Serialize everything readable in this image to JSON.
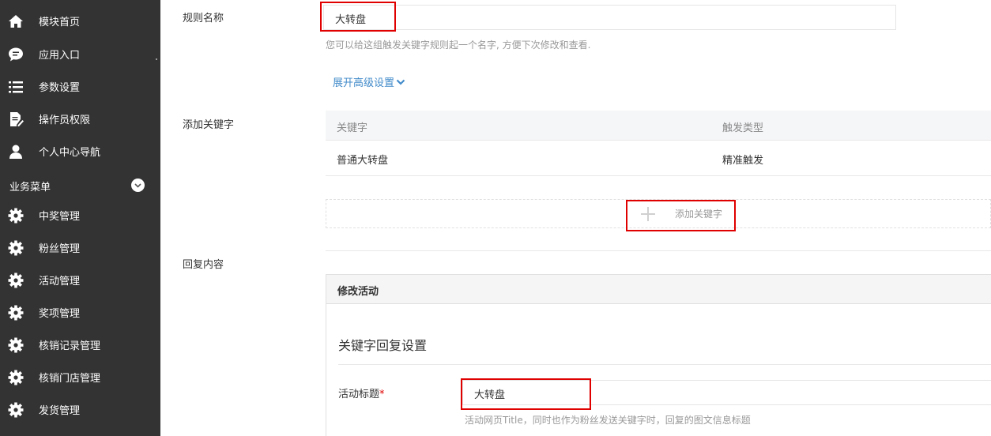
{
  "sidebar": {
    "items": [
      {
        "label": "模块首页",
        "icon": "home-icon"
      },
      {
        "label": "应用入口",
        "icon": "chat-icon"
      },
      {
        "label": "参数设置",
        "icon": "list-icon"
      },
      {
        "label": "操作员权限",
        "icon": "edit-doc-icon"
      },
      {
        "label": "个人中心导航",
        "icon": "user-icon"
      }
    ],
    "section_label": "业务菜单",
    "business_items": [
      {
        "label": "中奖管理",
        "icon": "gear-icon"
      },
      {
        "label": "粉丝管理",
        "icon": "gear-icon"
      },
      {
        "label": "活动管理",
        "icon": "gear-icon"
      },
      {
        "label": "奖项管理",
        "icon": "gear-icon"
      },
      {
        "label": "核销记录管理",
        "icon": "gear-icon"
      },
      {
        "label": "核销门店管理",
        "icon": "gear-icon"
      },
      {
        "label": "发货管理",
        "icon": "gear-icon"
      }
    ]
  },
  "form": {
    "rule_name_label": "规则名称",
    "rule_name_value": "大转盘",
    "rule_name_hint": "您可以给这组触发关键字规则起一个名字, 方便下次修改和查看.",
    "advanced_link": "展开高级设置",
    "add_keyword_label": "添加关键字",
    "table": {
      "headers": [
        "关键字",
        "触发类型"
      ],
      "rows": [
        [
          "普通大转盘",
          "精准触发"
        ]
      ]
    },
    "add_keyword_button": "添加关键字",
    "reply_label": "回复内容",
    "panel_title": "修改活动",
    "panel_section_title": "关键字回复设置",
    "activity_title_label": "活动标题",
    "required_mark": "*",
    "activity_title_value": "大转盘",
    "activity_title_hint": "活动网页Title，同时也作为粉丝发送关键字时，回复的图文信息标题"
  },
  "colors": {
    "sidebar_bg": "#333333",
    "highlight": "#e00000",
    "link": "#428bca"
  }
}
